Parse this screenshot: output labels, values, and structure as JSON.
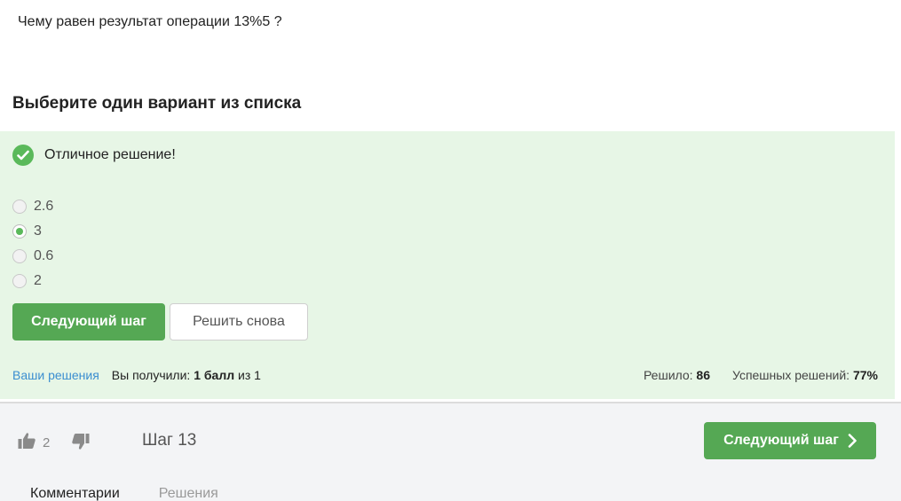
{
  "question": {
    "text": "Чему равен результат операции 13%5 ?"
  },
  "prompt": {
    "title": "Выберите один вариант из списка"
  },
  "feedback": {
    "text": "Отличное решение!",
    "status": "correct"
  },
  "options": [
    {
      "label": "2.6",
      "selected": false
    },
    {
      "label": "3",
      "selected": true
    },
    {
      "label": "0.6",
      "selected": false
    },
    {
      "label": "2",
      "selected": false
    }
  ],
  "actions": {
    "next_label": "Следующий шаг",
    "retry_label": "Решить снова"
  },
  "stats": {
    "your_solutions": "Ваши решения",
    "received_prefix": "Вы получили:",
    "score": "1 балл",
    "of_text": "из 1",
    "solved_label": "Решило:",
    "solved_count": "86",
    "success_label": "Успешных решений:",
    "success_rate": "77%"
  },
  "footer": {
    "likes": "2",
    "step_title": "Шаг 13",
    "next_label": "Следующий шаг",
    "tabs": [
      "Комментарии",
      "Решения"
    ]
  },
  "colors": {
    "accent": "#55a854",
    "panel_bg": "#e7f6e6",
    "link": "#3b8ed0"
  },
  "icons": [
    "check-icon",
    "thumbs-up-icon",
    "thumbs-down-icon",
    "chevron-right-icon"
  ]
}
